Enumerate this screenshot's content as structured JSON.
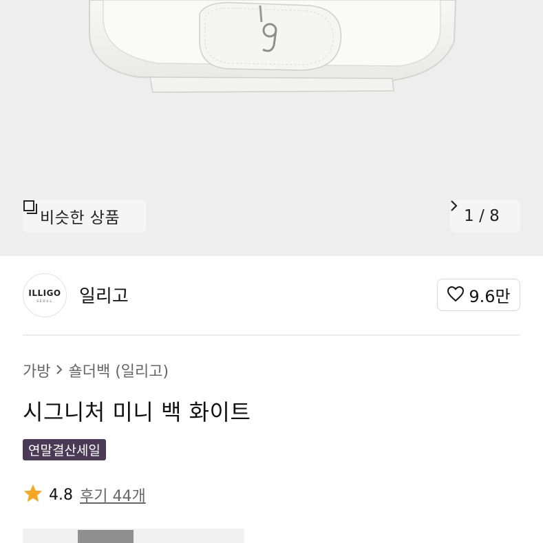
{
  "hero": {
    "image_name": "white shoulder bag product photo",
    "similar_button": {
      "icon": "similar-products-icon",
      "label": "비슷한 상품"
    },
    "counter": {
      "text": "1 / 8",
      "icon": "chevron-right-icon"
    }
  },
  "brand": {
    "logo_text": "ILLIGO",
    "logo_subtext": "SEOUL",
    "name": "일리고",
    "likes": "9.6만",
    "like_icon": "heart-outline-icon"
  },
  "breadcrumb": {
    "category": "가방",
    "separator_icon": "chevron-right-icon",
    "subcategory": "숄더백 (일리고)"
  },
  "product": {
    "title": "시그니처 미니 백 화이트",
    "badge": "연말결산세일"
  },
  "rating": {
    "icon": "star-icon",
    "score": "4.8",
    "reviews": "후기 44개",
    "star_color": "#f5a623"
  },
  "colors": {
    "badge_bg": "#4b3a56",
    "hero_bg": "#eeeeee"
  }
}
